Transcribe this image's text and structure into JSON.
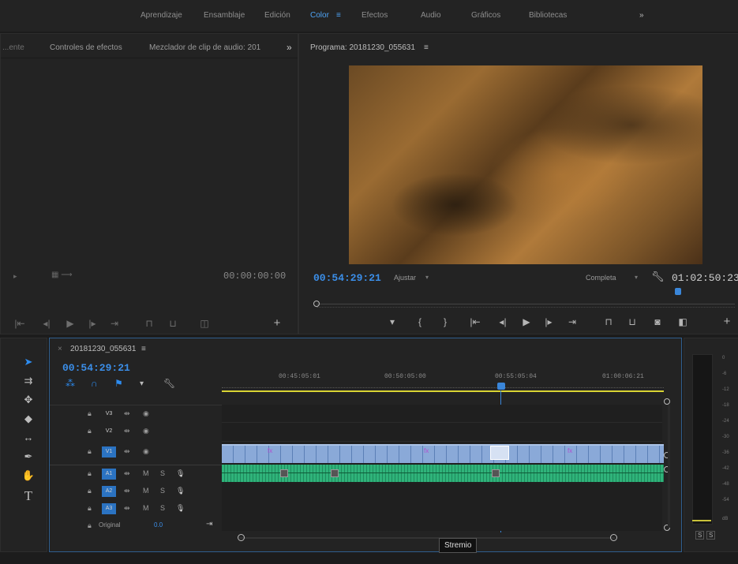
{
  "workspaces": {
    "items": [
      "Aprendizaje",
      "Ensamblaje",
      "Edición",
      "Color",
      "Efectos",
      "Audio",
      "Gráficos",
      "Bibliotecas"
    ],
    "active": "Color",
    "more": "»"
  },
  "source_panel": {
    "tabs": [
      "...ente",
      "Controles de efectos",
      "Mezclador de clip de audio: 201"
    ],
    "more": "»",
    "timecode": "00:00:00:00"
  },
  "program_monitor": {
    "title": "Programa: 20181230_055631",
    "menu": "≡",
    "timecode": "00:54:29:21",
    "fit": "Ajustar",
    "resolution": "Completa",
    "duration": "01:02:50:23"
  },
  "timeline": {
    "sequence_name": "20181230_055631",
    "menu": "≡",
    "timecode": "00:54:29:21",
    "ruler": [
      "00:45:05:01",
      "00:50:05:00",
      "00:55:05:04",
      "01:00:06:21"
    ],
    "video_tracks": [
      "V3",
      "V2",
      "V1"
    ],
    "audio_tracks": [
      "A1",
      "A2",
      "A3"
    ],
    "master_label": "Original",
    "master_value": "0.0"
  },
  "tooltip": "Stremio",
  "meter": {
    "labels": [
      "0",
      "-6",
      "-12",
      "-18",
      "-24",
      "-30",
      "-36",
      "-42",
      "-48",
      "-54",
      "dB"
    ],
    "buttons": [
      "S",
      "S"
    ]
  },
  "colors": {
    "accent": "#2d8cf0",
    "video_clip": "#8aa9d8",
    "audio_clip": "#2fb37a",
    "playhead": "#3a86d9",
    "work_area": "#d9d433"
  }
}
